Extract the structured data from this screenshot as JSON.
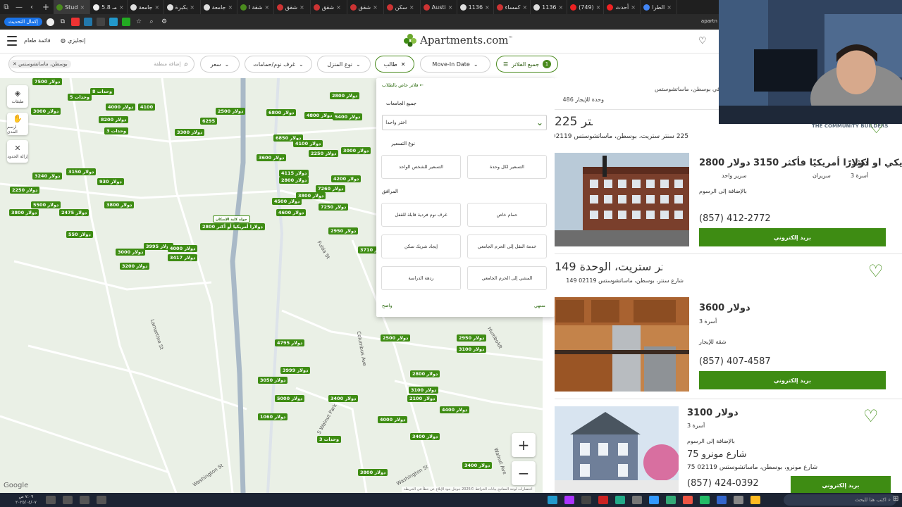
{
  "browser": {
    "tabs": [
      {
        "label": "Stud"
      },
      {
        "label": "5.8 مـ"
      },
      {
        "label": "جامعة"
      },
      {
        "label": "بكبرة"
      },
      {
        "label": "جامعة"
      },
      {
        "label": "شقة ا"
      },
      {
        "label": "شقق"
      },
      {
        "label": "شقق"
      },
      {
        "label": "شقق"
      },
      {
        "label": "سكن"
      },
      {
        "label": "Austi"
      },
      {
        "label": "1136"
      },
      {
        "label": "كمساء"
      },
      {
        "label": "1136"
      },
      {
        "label": "(749)"
      },
      {
        "label": "أحدث"
      },
      {
        "label": "الطرا"
      }
    ],
    "update_label": "إكمال التحديث",
    "url_domain": "apartn"
  },
  "site": {
    "menu_label": "قائمة طعام",
    "language": "إنجليزي",
    "logo_text": "Apartments.com",
    "logo_tm": "™"
  },
  "filters": {
    "search_chip": "بوسطن، ماساتشوستس",
    "search_placeholder": "إضافة منطقة",
    "price": "سعر",
    "beds": "غرف نوم/حمامات",
    "home_type": "نوع المنزل",
    "student": "طالب",
    "move_in": "Move-In Date",
    "all_filters": "جميع الفلاتر",
    "all_count": "1"
  },
  "map": {
    "controls": [
      {
        "label": "طبقات"
      },
      {
        "label": "ارسم المدى"
      },
      {
        "label": "إزالة الحدود"
      }
    ],
    "pins": [
      {
        "label": "7500 دولار"
      },
      {
        "label": "8 وحدات"
      },
      {
        "label": "5 وحدات"
      },
      {
        "label": "3000 دولار"
      },
      {
        "label": "4000 دولار"
      },
      {
        "label": "4100"
      },
      {
        "label": "8200 دولار"
      },
      {
        "label": "3 وحدات"
      },
      {
        "label": "3300 دولار"
      },
      {
        "label": "6295"
      },
      {
        "label": "6800 دولار"
      },
      {
        "label": "2500 دولار"
      },
      {
        "label": "2800 دولار"
      },
      {
        "label": "4800 دولار"
      },
      {
        "label": "5400 دولار"
      },
      {
        "label": "3000 دولار"
      },
      {
        "label": "6850 دولار"
      },
      {
        "label": "4100 دولار"
      },
      {
        "label": "2250 دولار"
      },
      {
        "label": "3600 دولار"
      },
      {
        "label": "3150 دولار"
      },
      {
        "label": "3240 دولار"
      },
      {
        "label": "930 دولار"
      },
      {
        "label": "2250 دولار"
      },
      {
        "label": "3800 دولار"
      },
      {
        "label": "5500 دولار"
      },
      {
        "label": "2475 دولار"
      },
      {
        "label": "3800 دولار"
      },
      {
        "label": "4115 دولار"
      },
      {
        "label": "4200 دولار"
      },
      {
        "label": "2800 دولار"
      },
      {
        "label": "7260 دولار"
      },
      {
        "label": "3800 دولار"
      },
      {
        "label": "4500 دولار"
      },
      {
        "label": "4600 دولار"
      },
      {
        "label": "7250 دولار"
      },
      {
        "label": "2800 دولارا أمريكيا أو أكثر"
      },
      {
        "label": "2950 دولار"
      },
      {
        "label": "550 دولار"
      },
      {
        "label": "3000 دولار"
      },
      {
        "label": "3995 دولار"
      },
      {
        "label": "4000 دولار"
      },
      {
        "label": "3417 دولار"
      },
      {
        "label": "3200 دولار"
      },
      {
        "label": "3710 دولار"
      },
      {
        "label": "4795 دولار"
      },
      {
        "label": "2500 دولار"
      },
      {
        "label": "2950 دولار"
      },
      {
        "label": "3100 دولار"
      },
      {
        "label": "3999 دولار"
      },
      {
        "label": "3050 دولار"
      },
      {
        "label": "2800 دولار"
      },
      {
        "label": "3100 دولار"
      },
      {
        "label": "5000 دولار"
      },
      {
        "label": "2100 دولار"
      },
      {
        "label": "3400 دولار"
      },
      {
        "label": "4400 دولار"
      },
      {
        "label": "4000 دولار"
      },
      {
        "label": "1060 دولار"
      },
      {
        "label": "3 وحدات"
      },
      {
        "label": "3400 دولار"
      },
      {
        "label": "3800 دولار"
      },
      {
        "label": "3400 دولار"
      }
    ],
    "selected_pin": "جولة كلية الإسكان",
    "streets": [
      {
        "label": "Columbus Ave"
      },
      {
        "label": "Lamartine St"
      },
      {
        "label": "Washington St"
      },
      {
        "label": "S Walnut Park"
      },
      {
        "label": "Fulda St"
      },
      {
        "label": "Humboldt"
      },
      {
        "label": "Walnut Ave"
      },
      {
        "label": "Washington St"
      }
    ],
    "google": "Google",
    "attribution": "اختصارات لوحة المفاتيح  بيانات الخرائط ©2025 جوجل  بنود  الإبلاغ عن خطأ في الخريطة"
  },
  "filter_popup": {
    "back": "فلاتر  خاص بالطلاب",
    "universities_label": "جميع الجامعات",
    "select_value": "اختر واحدا",
    "pricing_label": "نوع التسعير",
    "pricing_options": [
      {
        "label": "التسعير لكل وحدة"
      },
      {
        "label": "التسعير للشخص الواحد"
      }
    ],
    "amenities_label": "المرافق",
    "amenities": [
      {
        "label": "حمام خاص"
      },
      {
        "label": "غرف نوم فردية قابلة للقفل"
      },
      {
        "label": "خدمة النقل إلى الحرم الجامعي"
      },
      {
        "label": "إيجاد شريك سكن"
      },
      {
        "label": "المشي إلى الحرم الجامعي"
      },
      {
        "label": "ردهة الدراسة"
      }
    ],
    "clear": "واضح",
    "done": "منتهي"
  },
  "listings": {
    "summary": "شقق طلابية للإيجار في بوسطن، ماساتشوستس",
    "count": "486 وحدة للإيجار",
    "items": [
      {
        "title": "225 سنتر",
        "address": "225 سنتر ستريت، بوسطن، ماساتشوستس 02119",
        "brand": "THE COMMUNITY BUILDERS"
      },
      {
        "price_1": "2800 دولار",
        "price_1_sub": "سرير واحد",
        "price_2": "3150 دولارًا أمريكيًا فأكثر",
        "price_2_sub": "سريران",
        "price_3": "مريكي أو أكثر",
        "price_3_sub": "3 أسرة",
        "note": "بالإضافة إلى الرسوم",
        "phone": "(857) 412-2772",
        "email": "بريد إلكتروني"
      },
      {
        "title": "149 سنتر ستريت، الوحدة",
        "address": "149 شارع سنتر، بوسطن، ماساتشوستس 02119",
        "price": "3600 دولار",
        "beds": "3 أسرة",
        "type": "شقة للإيجار",
        "phone": "(857) 407-4587",
        "email": "بريد إلكتروني"
      },
      {
        "price": "3100 دولار",
        "beds": "3 أسرة",
        "note": "بالإضافة إلى الرسوم",
        "title": "75 شارع مونرو",
        "address": "75 شارع مونرو، بوسطن، ماساتشوستس 02119",
        "phone": "(857) 424-0392",
        "email": "بريد إلكتروني"
      }
    ]
  },
  "taskbar": {
    "search_placeholder": "اكتب هنا للبحث",
    "time": "٧:٠٩ ص",
    "date": "٢٠٢٥/٠٤/٠٧"
  },
  "colors": {
    "brand_green": "#3e8c13",
    "map_bg": "#eaf0e6"
  }
}
